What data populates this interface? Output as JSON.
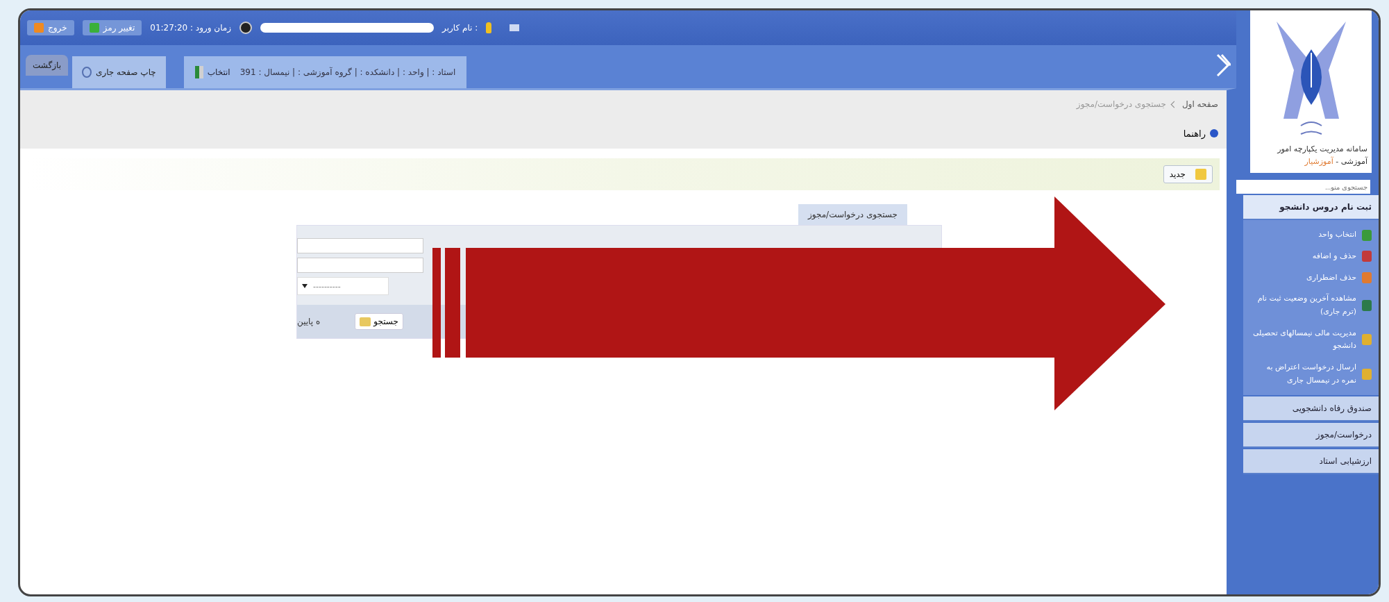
{
  "top_bar": {
    "user_label": "نام کاربر :",
    "login_time": "زمان ورود : 01:27:20",
    "change_password": "تغییر رمز",
    "logout": "خروج"
  },
  "context_bar": {
    "text": "استاد : | واحد : | دانشکده : | گروه آموزشی : | نیمسال : 391",
    "select_button": "انتخاب",
    "print_button": "چاپ صفحه جاری",
    "back_button": "بازگشت"
  },
  "breadcrumb": [
    "صفحه اول",
    "جستجوی درخواست/مجوز"
  ],
  "help_link": "راهنما",
  "toolbar": {
    "new_button": "جدید"
  },
  "search_panel": {
    "title": "جستجوی درخواست/مجوز",
    "fields": [
      {
        "kind": "text"
      },
      {
        "kind": "text"
      },
      {
        "kind": "select",
        "value": "----------"
      }
    ],
    "footer_text": "ه پایین",
    "search_button": "جستجو"
  },
  "sidebar": {
    "system_title": "سامانه مدیریت یکپارچه امور آموزشی - ",
    "system_name": "آموزشیار",
    "menu_search": {
      "placeholder": "جستجوی منو..."
    },
    "menu": [
      {
        "label": "ثبت نام دروس دانشجو",
        "expanded": true,
        "children": [
          {
            "label": "انتخاب واحد"
          },
          {
            "label": "حذف و اضافه"
          },
          {
            "label": "حذف اضطراری"
          },
          {
            "label": "مشاهده آخرین وضعیت ثبت نام (ترم جاری)"
          },
          {
            "label": "مدیریت مالی نیمسالهای تحصیلی دانشجو"
          },
          {
            "label": "ارسال درخواست اعتراض به نمره در نیمسال جاری"
          }
        ]
      },
      {
        "label": "صندوق رفاه دانشجویی",
        "expanded": false
      },
      {
        "label": "درخواست/مجوز",
        "expanded": false
      },
      {
        "label": "ارزشیابی استاد",
        "expanded": false
      }
    ]
  }
}
